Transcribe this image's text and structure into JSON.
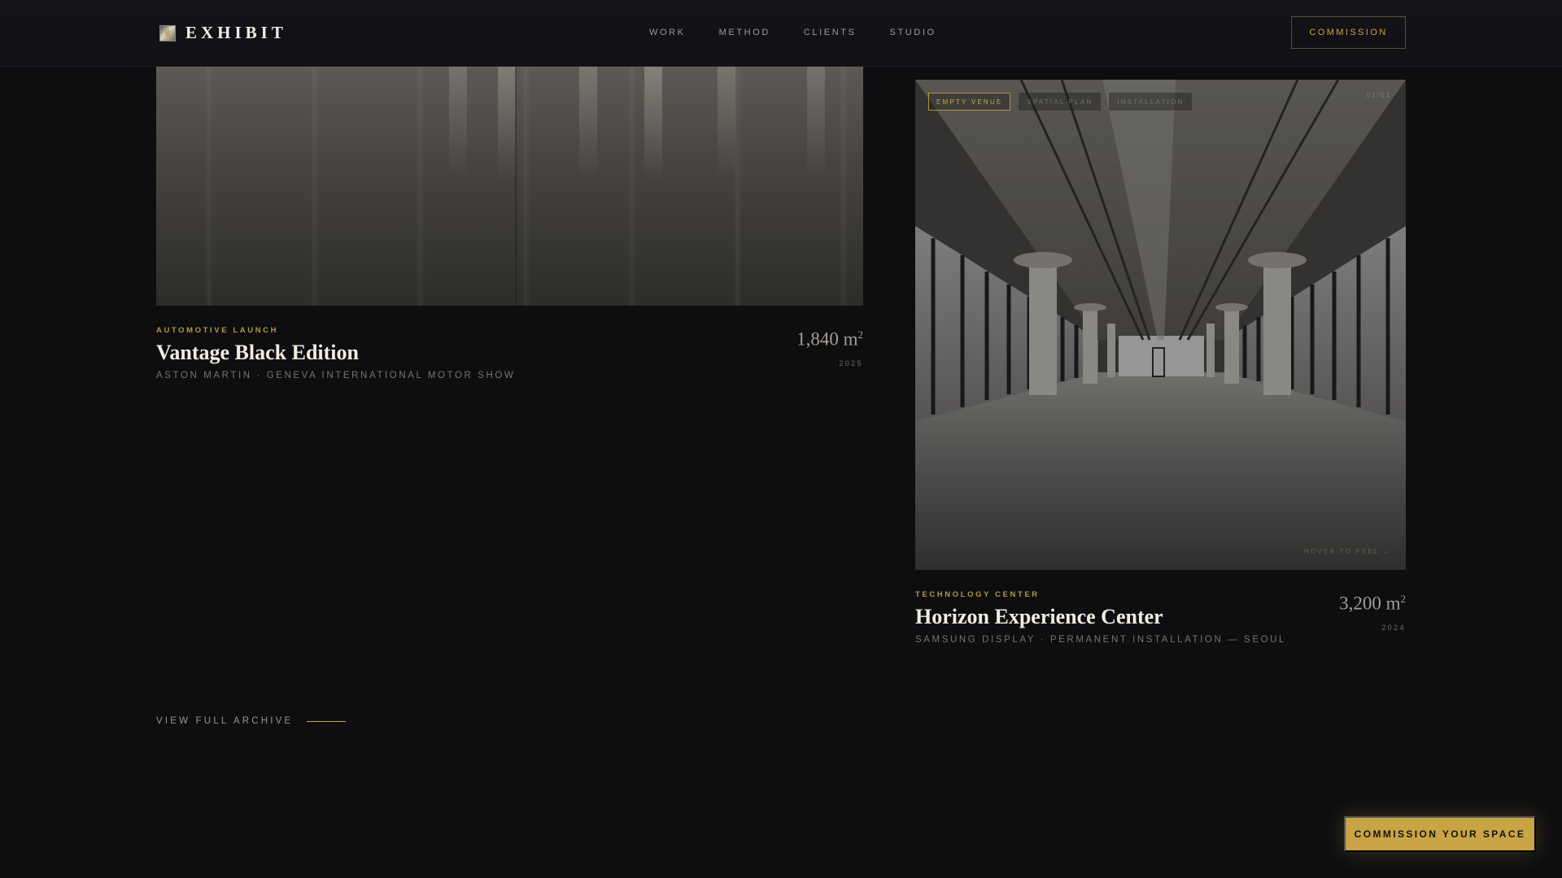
{
  "header": {
    "logo_text": "EXHIBIT",
    "nav": [
      "WORK",
      "METHOD",
      "CLIENTS",
      "STUDIO"
    ],
    "commission_label": "COMMISSION"
  },
  "projects": [
    {
      "category": "AUTOMOTIVE LAUNCH",
      "title": "Vantage Black Edition",
      "subtitle": "ASTON MARTIN · GENEVA INTERNATIONAL MOTOR SHOW",
      "area_value": "1,840 m",
      "area_unit_sup": "2",
      "year": "2025"
    },
    {
      "category": "TECHNOLOGY CENTER",
      "title": "Horizon Experience Center",
      "subtitle": "SAMSUNG DISPLAY · PERMANENT INSTALLATION — SEOUL",
      "area_value": "3,200 m",
      "area_unit_sup": "2",
      "year": "2024",
      "tags": [
        "EMPTY VENUE",
        "SPATIAL PLAN",
        "INSTALLATION"
      ],
      "active_tag": "EMPTY VENUE",
      "photo_corner": "01/03",
      "photo_hint": "HOVER TO PEEL →"
    }
  ],
  "archive_label": "VIEW FULL ARCHIVE",
  "cta_label": "COMMISSION YOUR SPACE",
  "colors": {
    "background": "#0e0e11",
    "accent_gold": "#c9a445",
    "title_text": "#f0ece2",
    "muted_text": "#77736c"
  },
  "icons": [
    "logo-mark-icon"
  ]
}
